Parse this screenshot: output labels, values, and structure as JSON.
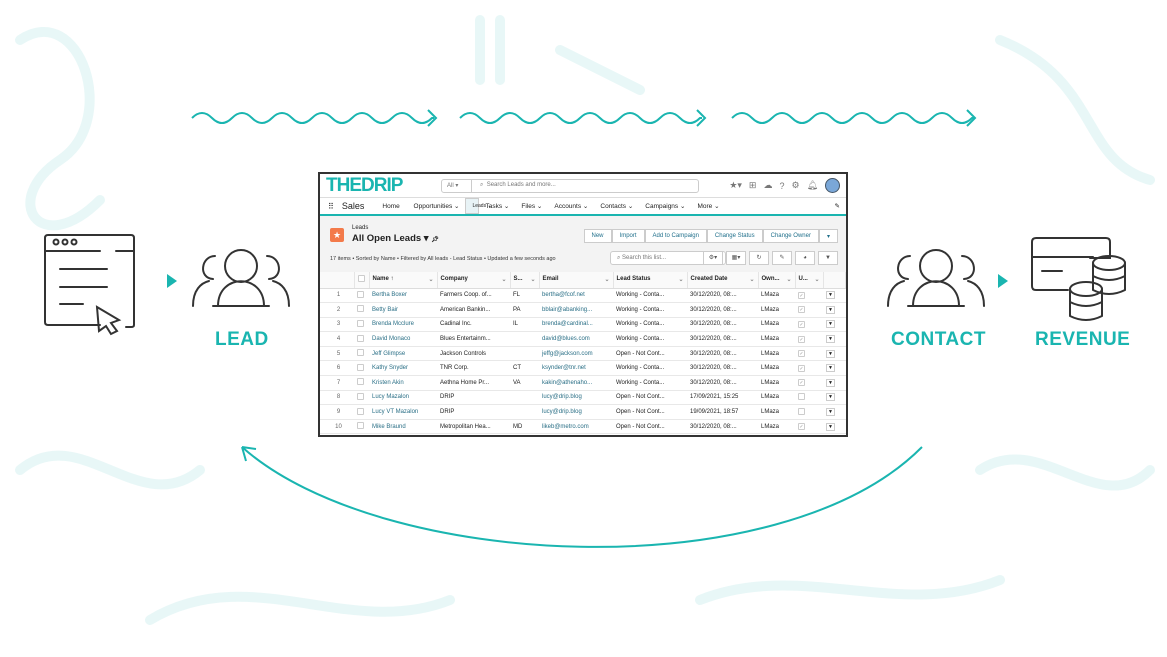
{
  "colors": {
    "accent": "#1ab5b0",
    "lead_icon": "#f37a4a",
    "link": "#2a6f86"
  },
  "flow": {
    "lead_label": "LEAD",
    "contact_label": "CONTACT",
    "revenue_label": "REVENUE"
  },
  "app": {
    "logo": "THEDRIP",
    "search_scope": "All",
    "search_placeholder": "Search Leads and more...",
    "app_name": "Sales",
    "nav": [
      "Home",
      "Opportunities",
      "Leads",
      "Tasks",
      "Files",
      "Accounts",
      "Contacts",
      "Campaigns",
      "More"
    ],
    "object": "Leads",
    "list_view": "All Open Leads",
    "meta": "17 items • Sorted by Name • Filtered by All leads - Lead Status • Updated a few seconds ago",
    "buttons": [
      "New",
      "Import",
      "Add to Campaign",
      "Change Status",
      "Change Owner"
    ],
    "list_search_placeholder": "Search this list...",
    "columns": [
      "Name ↑",
      "Company",
      "S...",
      "Email",
      "Lead Status",
      "Created Date",
      "Own...",
      "U..."
    ],
    "rows": [
      {
        "n": "1",
        "name": "Bertha Boxer",
        "company": "Farmers Coop. of...",
        "state": "FL",
        "email": "bertha@fcof.net",
        "status": "Working - Conta...",
        "created": "30/12/2020, 08:...",
        "owner": "LMaza",
        "u": true
      },
      {
        "n": "2",
        "name": "Betty Bair",
        "company": "American Bankin...",
        "state": "PA",
        "email": "bblair@abanking...",
        "status": "Working - Conta...",
        "created": "30/12/2020, 08:...",
        "owner": "LMaza",
        "u": true
      },
      {
        "n": "3",
        "name": "Brenda Mcclure",
        "company": "Cadinal Inc.",
        "state": "IL",
        "email": "brenda@cardinal...",
        "status": "Working - Conta...",
        "created": "30/12/2020, 08:...",
        "owner": "LMaza",
        "u": true
      },
      {
        "n": "4",
        "name": "David Monaco",
        "company": "Blues Entertainm...",
        "state": "",
        "email": "david@blues.com",
        "status": "Working - Conta...",
        "created": "30/12/2020, 08:...",
        "owner": "LMaza",
        "u": true
      },
      {
        "n": "5",
        "name": "Jeff Glimpse",
        "company": "Jackson Controls",
        "state": "",
        "email": "jeffg@jackson.com",
        "status": "Open - Not Cont...",
        "created": "30/12/2020, 08:...",
        "owner": "LMaza",
        "u": true
      },
      {
        "n": "6",
        "name": "Kathy Snyder",
        "company": "TNR Corp.",
        "state": "CT",
        "email": "ksynder@tnr.net",
        "status": "Working - Conta...",
        "created": "30/12/2020, 08:...",
        "owner": "LMaza",
        "u": true
      },
      {
        "n": "7",
        "name": "Kristen Akin",
        "company": "Aethna Home Pr...",
        "state": "VA",
        "email": "kakin@athenaho...",
        "status": "Working - Conta...",
        "created": "30/12/2020, 08:...",
        "owner": "LMaza",
        "u": true
      },
      {
        "n": "8",
        "name": "Lucy Mazalon",
        "company": "DRIP",
        "state": "",
        "email": "lucy@drip.blog",
        "status": "Open - Not Cont...",
        "created": "17/09/2021, 15:25",
        "owner": "LMaza",
        "u": false
      },
      {
        "n": "9",
        "name": "Lucy VT Mazalon",
        "company": "DRIP",
        "state": "",
        "email": "lucy@drip.blog",
        "status": "Open - Not Cont...",
        "created": "19/09/2021, 18:57",
        "owner": "LMaza",
        "u": false
      },
      {
        "n": "10",
        "name": "Mike Braund",
        "company": "Metropolitan Hea...",
        "state": "MD",
        "email": "likeb@metro.com",
        "status": "Open - Not Cont...",
        "created": "30/12/2020, 08:...",
        "owner": "LMaza",
        "u": true
      }
    ]
  }
}
